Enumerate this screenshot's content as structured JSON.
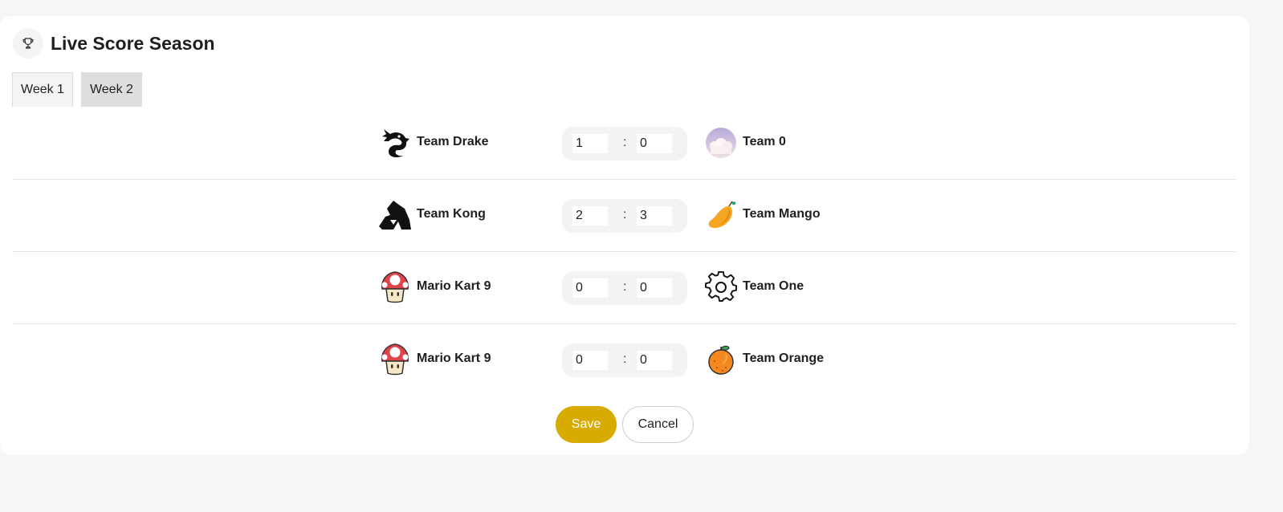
{
  "page": {
    "title": "Live Score Season",
    "title_icon": "trophy-icon"
  },
  "tabs": [
    {
      "label": "Week 1",
      "active": false
    },
    {
      "label": "Week 2",
      "active": true
    }
  ],
  "matches": [
    {
      "home": {
        "name": "Team Drake",
        "logo": "dragon-icon"
      },
      "home_score": "1",
      "away_score": "0",
      "away": {
        "name": "Team 0",
        "logo": "clouds-avatar"
      }
    },
    {
      "home": {
        "name": "Team Kong",
        "logo": "gorilla-icon"
      },
      "home_score": "2",
      "away_score": "3",
      "away": {
        "name": "Team Mango",
        "logo": "mango-icon"
      }
    },
    {
      "home": {
        "name": "Mario Kart 9",
        "logo": "mushroom-icon"
      },
      "home_score": "0",
      "away_score": "0",
      "away": {
        "name": "Team One",
        "logo": "gear-icon"
      }
    },
    {
      "home": {
        "name": "Mario Kart 9",
        "logo": "mushroom-icon"
      },
      "home_score": "0",
      "away_score": "0",
      "away": {
        "name": "Team Orange",
        "logo": "orange-icon"
      }
    }
  ],
  "score_separator": ":",
  "actions": {
    "save_label": "Save",
    "cancel_label": "Cancel"
  },
  "colors": {
    "accent": "#d7ab00",
    "background": "#f6f6f6",
    "card": "#ffffff"
  }
}
